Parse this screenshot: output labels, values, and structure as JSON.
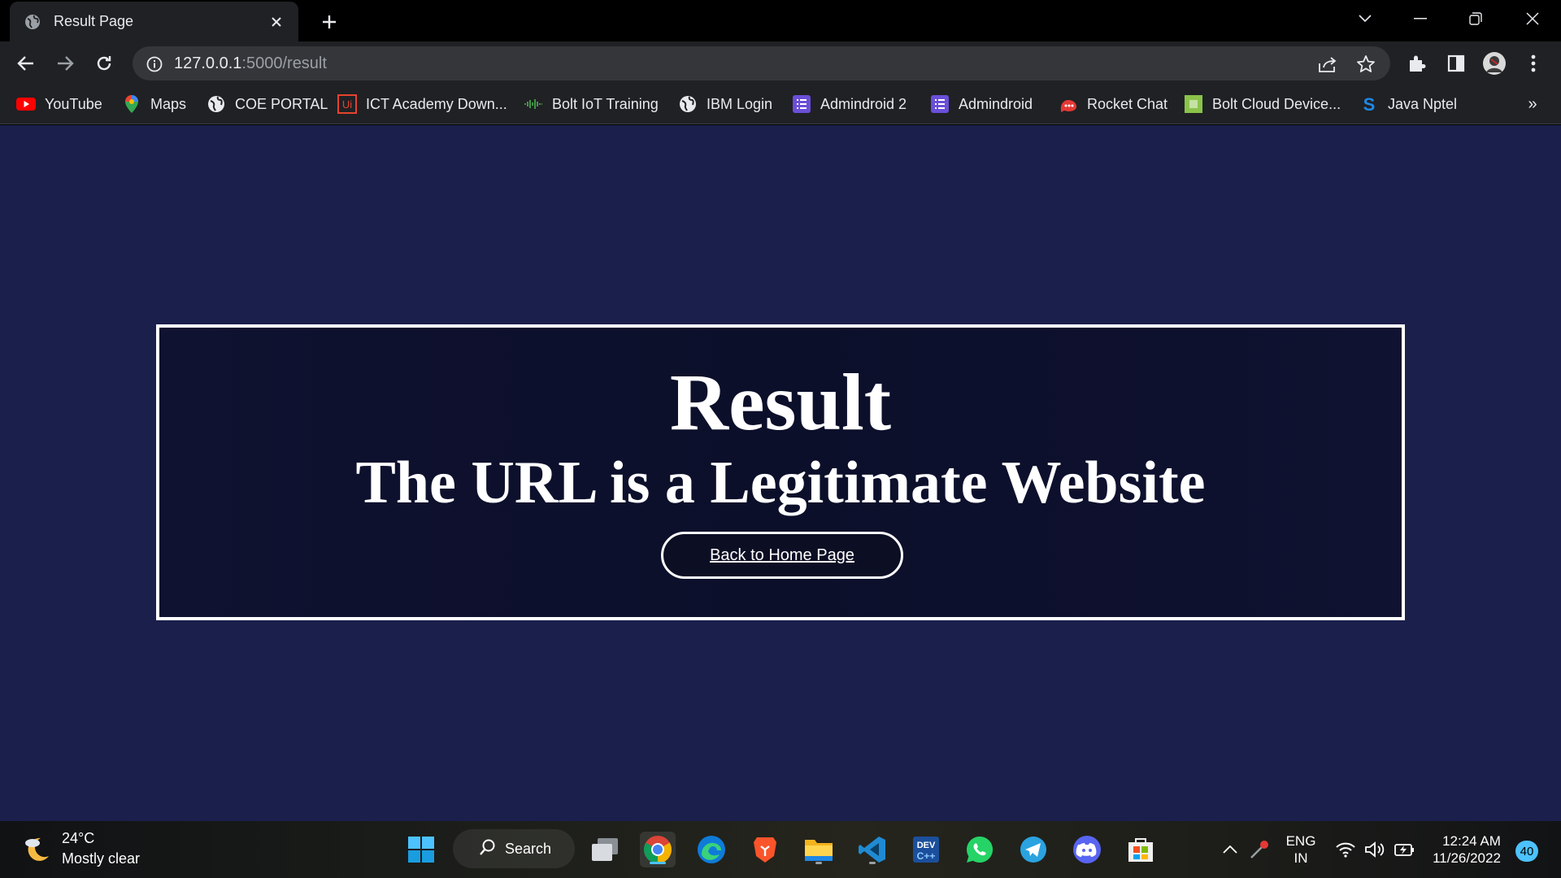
{
  "browser": {
    "tab": {
      "title": "Result Page",
      "favicon": "globe-icon"
    },
    "url": {
      "host": "127.0.0.1",
      "path": ":5000/result"
    },
    "bookmarks": [
      {
        "label": "YouTube",
        "icon": "youtube-icon",
        "color": "#ff0000"
      },
      {
        "label": "Maps",
        "icon": "maps-pin-icon",
        "color": "#34a853"
      },
      {
        "label": "COE PORTAL",
        "icon": "globe-icon",
        "color": "#e8eaed"
      },
      {
        "label": "ICT Academy Down...",
        "icon": "ui-logo-icon",
        "color": "#e4432e"
      },
      {
        "label": "Bolt IoT Training",
        "icon": "waveform-icon",
        "color": "#4caf50"
      },
      {
        "label": "IBM Login",
        "icon": "globe-icon",
        "color": "#e8eaed"
      },
      {
        "label": "Admindroid 2",
        "icon": "list-icon",
        "color": "#6b4fd8"
      },
      {
        "label": "Admindroid",
        "icon": "list-icon",
        "color": "#6b4fd8"
      },
      {
        "label": "Rocket Chat",
        "icon": "rocket-icon",
        "color": "#e53935"
      },
      {
        "label": "Bolt Cloud Device...",
        "icon": "chip-icon",
        "color": "#8bc34a"
      },
      {
        "label": "Java Nptel",
        "icon": "swayam-icon",
        "color": "#1e88e5"
      }
    ],
    "bookmarks_more": "»"
  },
  "page": {
    "heading": "Result",
    "message": "The URL is a Legitimate Website",
    "back_link": "Back to Home Page",
    "colors": {
      "background": "#1b1f4c",
      "box": "#0c0f2a",
      "text": "#ffffff"
    }
  },
  "taskbar": {
    "weather": {
      "temp": "24°C",
      "desc": "Mostly clear"
    },
    "search_label": "Search",
    "apps": [
      "windows-start-icon",
      "task-view-icon",
      "chrome-icon",
      "edge-icon",
      "brave-icon",
      "file-explorer-icon",
      "vscode-icon",
      "devcpp-icon",
      "whatsapp-icon",
      "telegram-icon",
      "discord-icon",
      "ms-store-icon"
    ],
    "language": {
      "line1": "ENG",
      "line2": "IN"
    },
    "clock": {
      "time": "12:24 AM",
      "date": "11/26/2022"
    },
    "notifications": "40"
  }
}
